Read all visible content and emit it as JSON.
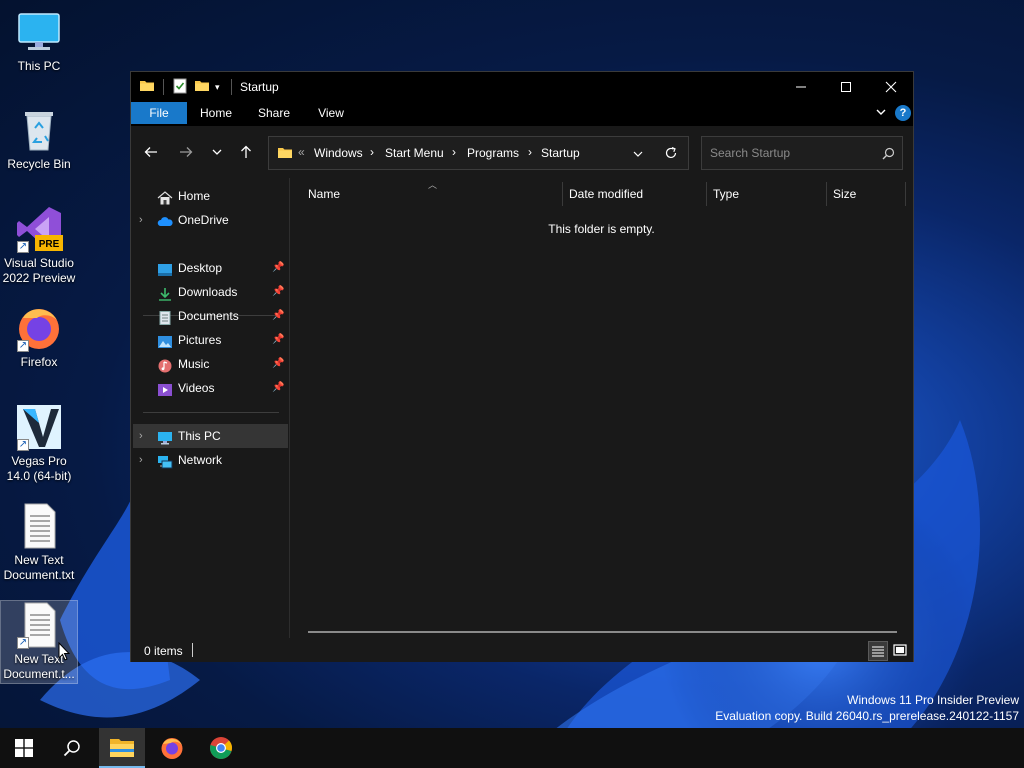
{
  "desktop": {
    "icons": [
      {
        "label_line1": "This PC",
        "label_line2": ""
      },
      {
        "label_line1": "Recycle Bin",
        "label_line2": ""
      },
      {
        "label_line1": "Visual Studio",
        "label_line2": "2022 Preview",
        "badge": "PRE"
      },
      {
        "label_line1": "Firefox",
        "label_line2": ""
      },
      {
        "label_line1": "Vegas Pro",
        "label_line2": "14.0 (64-bit)"
      },
      {
        "label_line1": "New Text",
        "label_line2": "Document.txt"
      },
      {
        "label_line1": "New Text",
        "label_line2": "Document.t..."
      }
    ]
  },
  "window": {
    "title": "Startup",
    "controls": {
      "minimize": "—",
      "maximize": "☐",
      "close": "✕"
    }
  },
  "ribbon": {
    "tabs": [
      "File",
      "Home",
      "Share",
      "View"
    ],
    "help": "?"
  },
  "address": {
    "overflow": "«",
    "crumbs": [
      "Windows",
      "Start Menu",
      "Programs",
      "Startup"
    ]
  },
  "search": {
    "placeholder": "Search Startup"
  },
  "navpane": {
    "quick": [
      {
        "label": "Home"
      },
      {
        "label": "OneDrive"
      }
    ],
    "pinned": [
      {
        "label": "Desktop"
      },
      {
        "label": "Downloads"
      },
      {
        "label": "Documents"
      },
      {
        "label": "Pictures"
      },
      {
        "label": "Music"
      },
      {
        "label": "Videos"
      }
    ],
    "devices": [
      {
        "label": "This PC"
      },
      {
        "label": "Network"
      }
    ]
  },
  "columns": {
    "name": "Name",
    "date": "Date modified",
    "type": "Type",
    "size": "Size"
  },
  "content": {
    "empty_message": "This folder is empty."
  },
  "status": {
    "items": "0 items"
  },
  "watermark": {
    "line1": "Windows 11 Pro Insider Preview",
    "line2": "Evaluation copy. Build 26040.rs_prerelease.240122-1157"
  },
  "colors": {
    "accent": "#1979ca",
    "window_bg": "#191919",
    "titlebar": "#000000"
  }
}
